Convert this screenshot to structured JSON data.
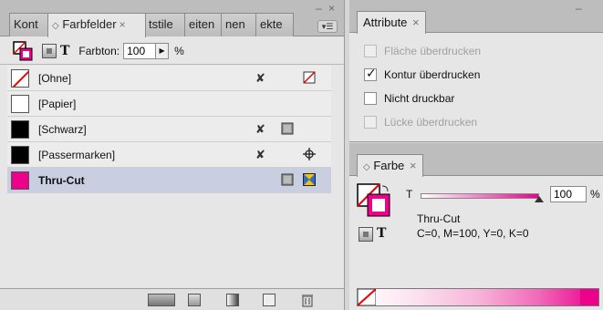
{
  "left_panel": {
    "tabs": [
      {
        "label": "Kont"
      },
      {
        "label": "Farbfelder",
        "close": "×"
      },
      {
        "label": "tstile"
      },
      {
        "label": "eiten"
      },
      {
        "label": "nen"
      },
      {
        "label": "ekte"
      }
    ],
    "collapse": "– ×",
    "panel_menu": "▾☰",
    "toolbar": {
      "farbton_label": "Farbton:",
      "farbton_value": "100",
      "percent": "%",
      "arrow": "▶",
      "t_label": "T"
    },
    "swatches": [
      {
        "label": "[Ohne]",
        "color": "#ffffff",
        "slash": true
      },
      {
        "label": "[Papier]",
        "color": "#ffffff"
      },
      {
        "label": "[Schwarz]",
        "color": "#000000"
      },
      {
        "label": "[Passermarken]",
        "color": "#000000"
      },
      {
        "label": "Thru-Cut",
        "color": "#ec008c",
        "selected": true
      }
    ]
  },
  "attribute_panel": {
    "tab": "Attribute",
    "close": "×",
    "collapse": "–",
    "options": [
      {
        "label": "Fläche überdrucken",
        "checked": false,
        "disabled": true
      },
      {
        "label": "Kontur überdrucken",
        "checked": true,
        "disabled": false
      },
      {
        "label": "Nicht druckbar",
        "checked": false,
        "disabled": false
      },
      {
        "label": "Lücke überdrucken",
        "checked": false,
        "disabled": true
      }
    ]
  },
  "farbe_panel": {
    "tab": "Farbe",
    "close": "×",
    "t_label": "T",
    "slider_label": "T",
    "slider_value": "100",
    "slider_fraction": 1.0,
    "percent": "%",
    "color_name": "Thru-Cut",
    "color_values": "C=0, M=100, Y=0, K=0",
    "accent": "#ec008c"
  }
}
